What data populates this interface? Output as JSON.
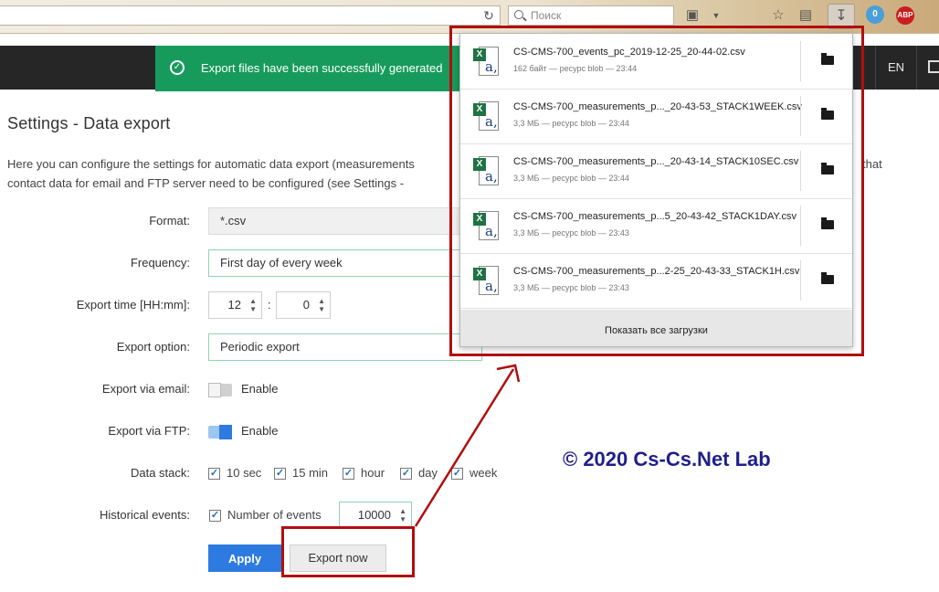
{
  "browser": {
    "search_placeholder": "Поиск",
    "lang_label": "EN",
    "badge_count": "0",
    "abp_label": "ABP"
  },
  "toast": {
    "message": "Export files have been successfully generated"
  },
  "page": {
    "title": "Settings - Data export",
    "desc_line1": "Here you can configure the settings for automatic data export (measurements",
    "desc_line2": "contact data for email and FTP server need to be configured (see Settings -",
    "desc_tail": "that"
  },
  "form": {
    "format_label": "Format:",
    "format_value": "*.csv",
    "frequency_label": "Frequency:",
    "frequency_value": "First day of every week",
    "export_time_label": "Export time [HH:mm]:",
    "hour_value": "12",
    "time_separator": ":",
    "minute_value": "0",
    "export_option_label": "Export option:",
    "export_option_value": "Periodic export",
    "email_label": "Export via email:",
    "email_toggle_label": "Enable",
    "email_enabled": false,
    "ftp_label": "Export via FTP:",
    "ftp_toggle_label": "Enable",
    "ftp_enabled": true,
    "data_stack_label": "Data stack:",
    "stack_options": [
      "10 sec",
      "15 min",
      "hour",
      "day",
      "week"
    ],
    "historical_label": "Historical events:",
    "number_of_events_label": "Number of events",
    "number_of_events_value": "10000",
    "apply_label": "Apply",
    "export_now_label": "Export now"
  },
  "downloads": {
    "items": [
      {
        "name": "CS-CMS-700_events_pc_2019-12-25_20-44-02.csv",
        "meta": "162 байт — ресурс blob — 23:44"
      },
      {
        "name": "CS-CMS-700_measurements_p..._20-43-53_STACK1WEEK.csv",
        "meta": "3,3 МБ — ресурс blob — 23:44"
      },
      {
        "name": "CS-CMS-700_measurements_p..._20-43-14_STACK10SEC.csv",
        "meta": "3,3 МБ — ресурс blob — 23:44"
      },
      {
        "name": "CS-CMS-700_measurements_p...5_20-43-42_STACK1DAY.csv",
        "meta": "3,3 МБ — ресурс blob — 23:43"
      },
      {
        "name": "CS-CMS-700_measurements_p...2-25_20-43-33_STACK1H.csv",
        "meta": "3,3 МБ — ресурс blob — 23:43"
      }
    ],
    "show_all_label": "Показать все загрузки"
  },
  "watermark": "© 2020 Cs-Cs.Net Lab",
  "colors": {
    "accent": "#2d7be0",
    "toast_green": "#179b5c",
    "highlight_red": "#b10e0e",
    "watermark": "#1f1f8a"
  }
}
